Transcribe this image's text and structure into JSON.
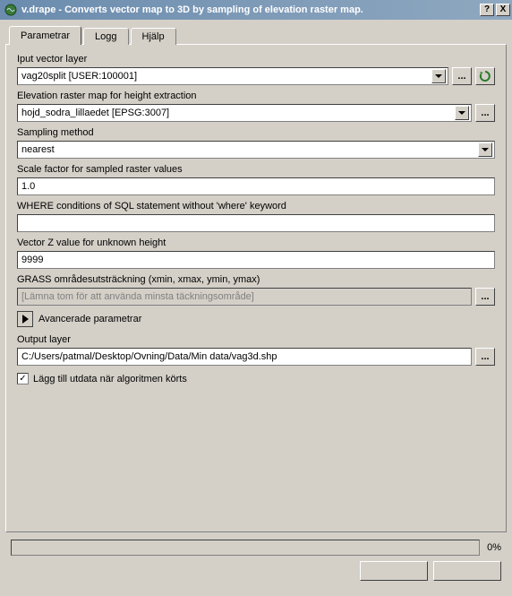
{
  "window": {
    "title": "v.drape - Converts vector map to 3D by sampling of elevation raster map."
  },
  "tabs": {
    "t0": "Parametrar",
    "t1": "Logg",
    "t2": "Hjälp"
  },
  "fields": {
    "input_layer": {
      "label": "Iput vector layer",
      "value": "vag20split [USER:100001]"
    },
    "elevation": {
      "label": "Elevation raster map for height extraction",
      "value": "hojd_sodra_lillaedet [EPSG:3007]"
    },
    "sampling": {
      "label": "Sampling method",
      "value": "nearest"
    },
    "scale": {
      "label": "Scale factor for sampled raster values",
      "value": "1.0"
    },
    "where": {
      "label": "WHERE conditions of SQL statement without 'where' keyword",
      "value": ""
    },
    "zvalue": {
      "label": "Vector Z value for unknown height",
      "value": "9999"
    },
    "extent": {
      "label": "GRASS områdesutsträckning (xmin, xmax, ymin, ymax)",
      "placeholder": "[Lämna tom för att använda minsta täckningsområde]"
    },
    "advanced": "Avancerade parametrar",
    "output": {
      "label": "Output layer",
      "value": "C:/Users/patmal/Desktop/Ovning/Data/Min data/vag3d.shp"
    },
    "add_output": "Lägg till utdata när algoritmen körts"
  },
  "buttons": {
    "browse": "...",
    "help": "?",
    "close": "X"
  },
  "progress": {
    "percent": "0%"
  }
}
